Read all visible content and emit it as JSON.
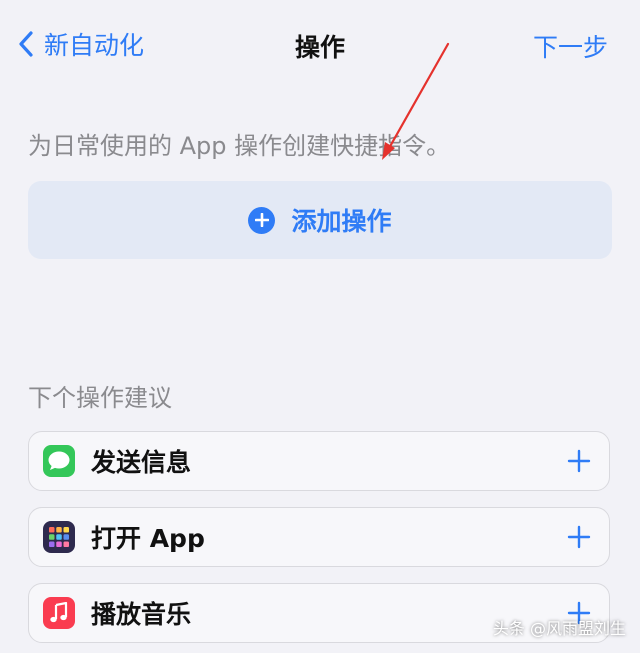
{
  "nav": {
    "back_label": "新自动化",
    "title": "操作",
    "next_label": "下一步"
  },
  "description": "为日常使用的 App 操作创建快捷指令。",
  "add_action": {
    "label": "添加操作",
    "icon": "plus-circle-icon"
  },
  "suggestions": {
    "header": "下个操作建议",
    "items": [
      {
        "label": "发送信息",
        "icon": "messages-icon"
      },
      {
        "label": "打开 App",
        "icon": "open-app-icon"
      },
      {
        "label": "播放音乐",
        "icon": "music-icon"
      }
    ]
  },
  "watermark": "头条 @风雨盟刘生",
  "colors": {
    "accent": "#2f7cf6",
    "background": "#f2f2f7",
    "add_action_bg": "#e3e9f5",
    "annotation_arrow": "#e5322d",
    "messages_green": "#34c759",
    "music_red": "#fa3c50"
  }
}
